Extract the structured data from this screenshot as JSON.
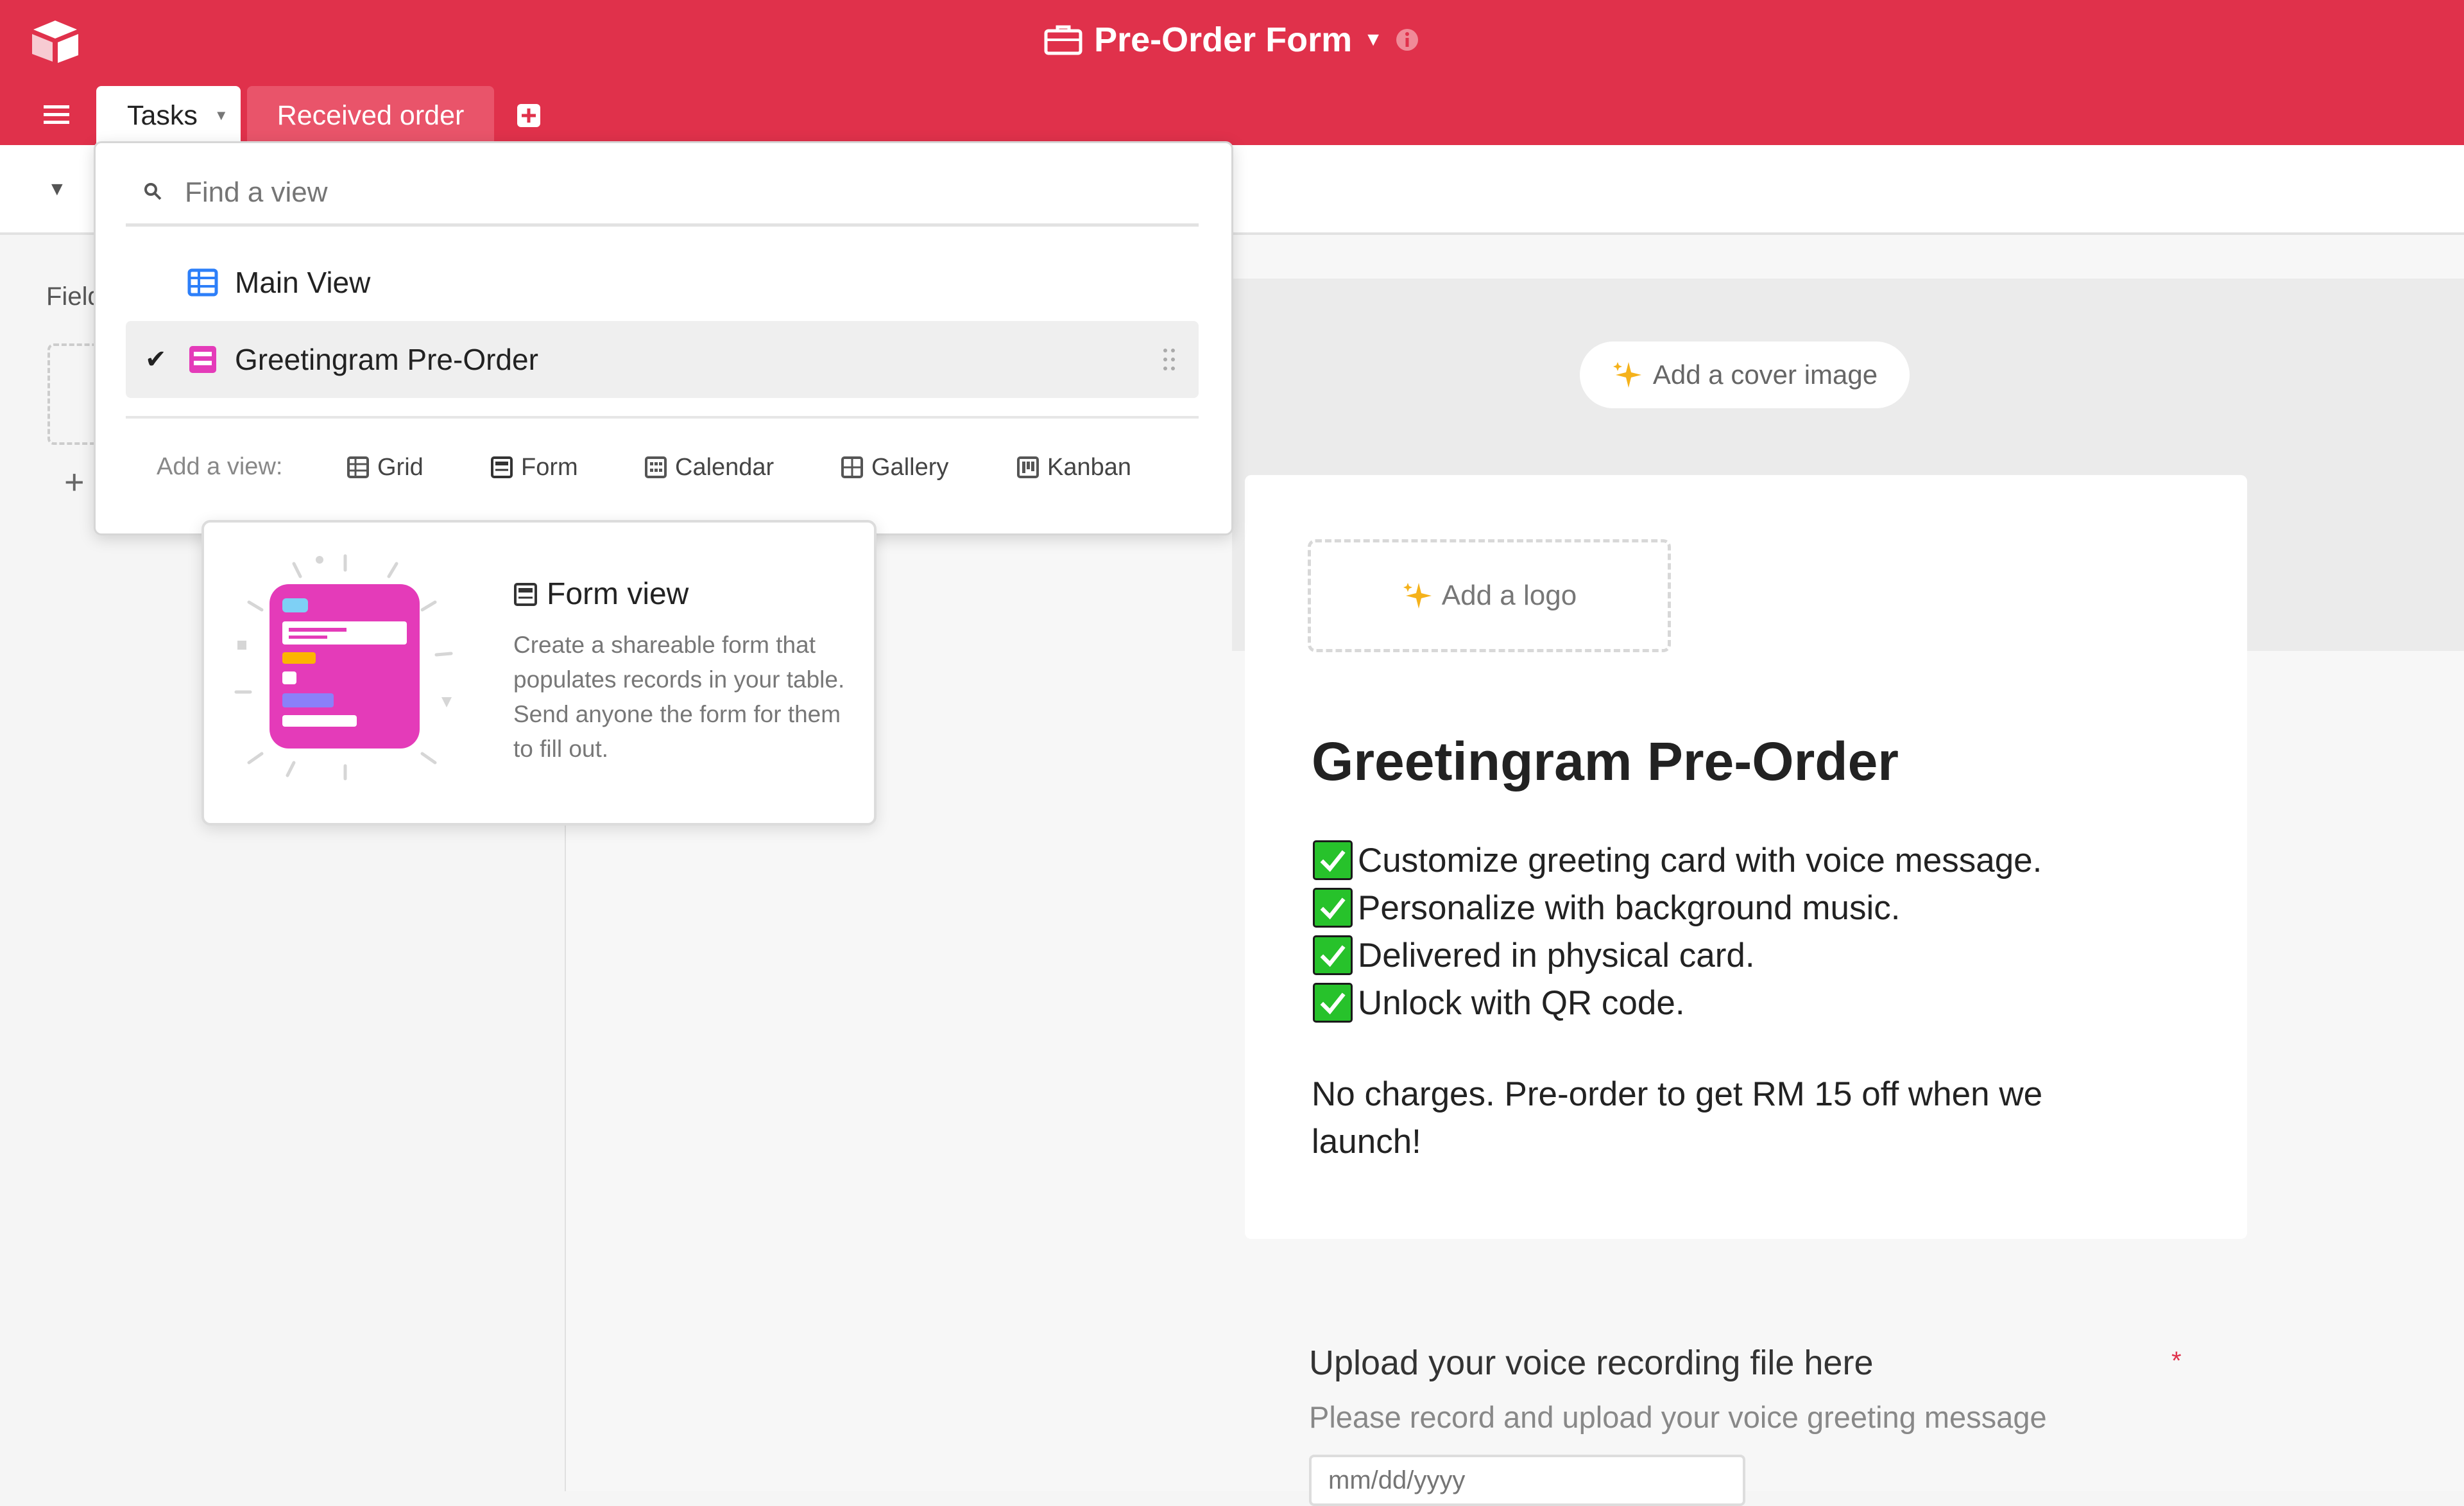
{
  "app": {
    "base_title": "Pre-Order Form"
  },
  "tabs": [
    {
      "label": "Tasks",
      "active": true
    },
    {
      "label": "Received order",
      "active": false
    }
  ],
  "sidebar": {
    "fields_label": "Field"
  },
  "view_switcher": {
    "search_placeholder": "Find a view",
    "views": [
      {
        "name": "Main View",
        "type": "grid",
        "selected": false
      },
      {
        "name": "Greetingram Pre-Order",
        "type": "form",
        "selected": true
      }
    ],
    "add_view_label": "Add a view:",
    "add_view_types": [
      "Grid",
      "Form",
      "Calendar",
      "Gallery",
      "Kanban"
    ]
  },
  "tooltip": {
    "title": "Form view",
    "description": "Create a shareable form that populates records in your table. Send anyone the form for them to fill out."
  },
  "form": {
    "cover_button": "Add a cover image",
    "logo_button": "Add a logo",
    "title": "Greetingram Pre-Order",
    "features": [
      "Customize greeting card with voice message.",
      "Personalize with background music.",
      "Delivered in physical card.",
      "Unlock with QR code."
    ],
    "promo": "No charges. Pre-order to get RM 15 off when we launch!",
    "field": {
      "label": "Upload your voice recording file here",
      "required_mark": "*",
      "help": "Please record and upload your voice greeting message",
      "input_placeholder": "mm/dd/yyyy"
    }
  },
  "colors": {
    "header": "#e0314b",
    "form_accent": "#e43bb9",
    "grid_accent": "#2d7ff9",
    "check_green": "#27c22b"
  }
}
